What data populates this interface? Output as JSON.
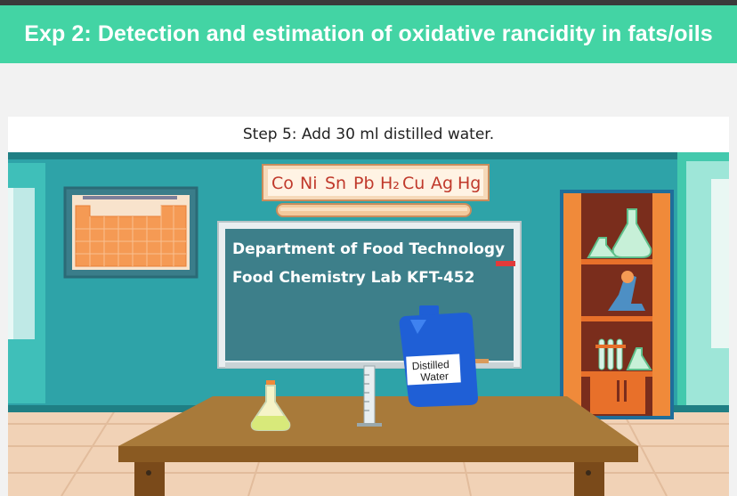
{
  "header": {
    "title": "Exp 2: Detection and estimation of oxidative rancidity in fats/oils"
  },
  "step": {
    "instruction": "Step 5: Add 30 ml distilled water."
  },
  "symbols_chart": {
    "symbols": [
      "Co",
      "Ni",
      "Sn",
      "Pb",
      "H₂",
      "Cu",
      "Ag",
      "Hg"
    ]
  },
  "blackboard": {
    "line1": "Department of Food Technology",
    "line2": "Food Chemistry Lab  KFT-452"
  },
  "bottle": {
    "label_line1": "Distilled",
    "label_line2": "Water"
  },
  "colors": {
    "header": "#43d4a4",
    "wall": "#2ea3a8",
    "board": "#3d7f8a",
    "table": "#a87a3a",
    "bottle": "#1f5fd6",
    "cabinet": "#e8702a"
  }
}
